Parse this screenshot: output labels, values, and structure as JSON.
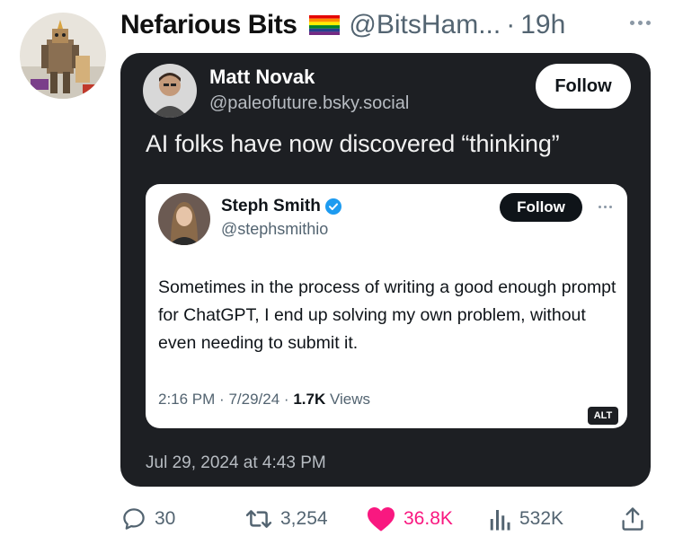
{
  "post": {
    "author_name": "Nefarious Bits",
    "author_handle": "@BitsHam...",
    "separator": "·",
    "time": "19h",
    "icons": {
      "flag": "rainbow-flag-icon",
      "more": "more-icon"
    }
  },
  "screenshot": {
    "author_name": "Matt Novak",
    "author_handle": "@paleofuture.bsky.social",
    "follow_label": "Follow",
    "text": "AI folks have now discovered “thinking”",
    "date": "Jul 29, 2024 at 4:43 PM",
    "quoted": {
      "author_name": "Steph Smith",
      "author_handle": "@stephsmithio",
      "follow_label": "Follow",
      "text": "Sometimes in the process of writing a good enough prompt for ChatGPT, I end up solving my own problem, without even needing to submit it.",
      "time": "2:16 PM",
      "date": "7/29/24",
      "sep1": "·",
      "sep2": "·",
      "views_count": "1.7K",
      "views_label": "Views",
      "alt_badge": "ALT",
      "icons": {
        "verified": "verified-badge-icon",
        "more": "more-icon"
      }
    }
  },
  "actions": {
    "replies": "30",
    "reposts": "3,254",
    "likes": "36.8K",
    "views": "532K",
    "icons": {
      "reply": "reply-icon",
      "repost": "repost-icon",
      "like": "heart-icon",
      "views": "views-icon",
      "share": "share-icon"
    }
  },
  "colors": {
    "like": "#f91880",
    "muted": "#536471",
    "verified": "#1d9bf0",
    "card_dark": "#1d1f23"
  }
}
